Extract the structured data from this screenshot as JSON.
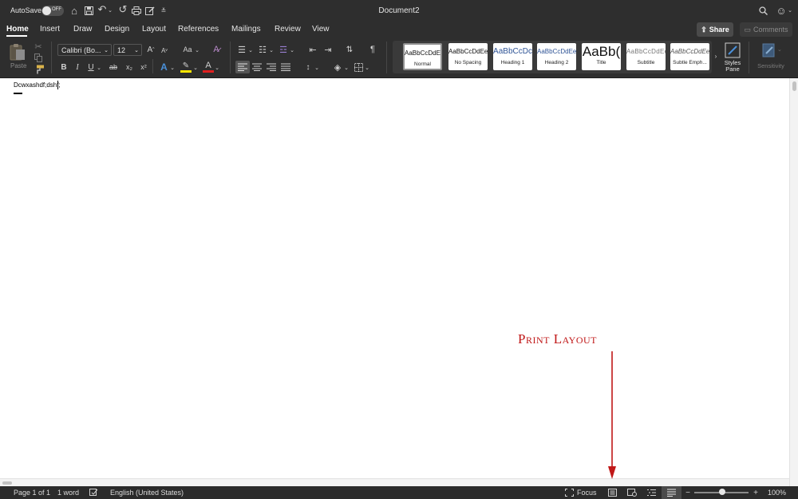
{
  "titlebar": {
    "autosave_label": "AutoSave",
    "autosave_state": "OFF",
    "document_title": "Document2"
  },
  "tabs": [
    {
      "label": "Home",
      "active": true
    },
    {
      "label": "Insert"
    },
    {
      "label": "Draw"
    },
    {
      "label": "Design"
    },
    {
      "label": "Layout"
    },
    {
      "label": "References"
    },
    {
      "label": "Mailings"
    },
    {
      "label": "Review"
    },
    {
      "label": "View"
    }
  ],
  "share": {
    "label": "Share"
  },
  "comments": {
    "label": "Comments"
  },
  "ribbon": {
    "paste_label": "Paste",
    "font_name": "Calibri (Bo...",
    "font_size": "12",
    "change_case": "Aa",
    "bold": "B",
    "italic": "I",
    "underline": "U",
    "strike": "ab",
    "subscript": "x₂",
    "superscript": "x²",
    "grow_font": "A",
    "shrink_font": "A",
    "pilcrow": "¶",
    "styles_pane_label": "Styles Pane",
    "sensitivity_label": "Sensitivity",
    "styles": [
      {
        "sample": "AaBbCcDdEe",
        "name": "Normal"
      },
      {
        "sample": "AaBbCcDdEe",
        "name": "No Spacing"
      },
      {
        "sample": "AaBbCcDc",
        "name": "Heading 1"
      },
      {
        "sample": "AaBbCcDdEe",
        "name": "Heading 2"
      },
      {
        "sample": "AaBb(",
        "name": "Title"
      },
      {
        "sample": "AaBbCcDdEe",
        "name": "Subtitle"
      },
      {
        "sample": "AaBbCcDdEe",
        "name": "Subtle Emph..."
      }
    ]
  },
  "document": {
    "text": "Dcwxashdf;dshf;"
  },
  "annotation": {
    "label": "Print Layout",
    "color": "#c01818"
  },
  "status": {
    "page": "Page 1 of 1",
    "words": "1 word",
    "language": "English (United States)",
    "focus": "Focus",
    "zoom": "100%",
    "zoom_level": 1.0
  },
  "colors": {
    "chrome": "#2e2e2e",
    "highlight_yellow": "#ffe600",
    "font_red": "#e02020",
    "text_effects_blue": "#4a90d9"
  }
}
